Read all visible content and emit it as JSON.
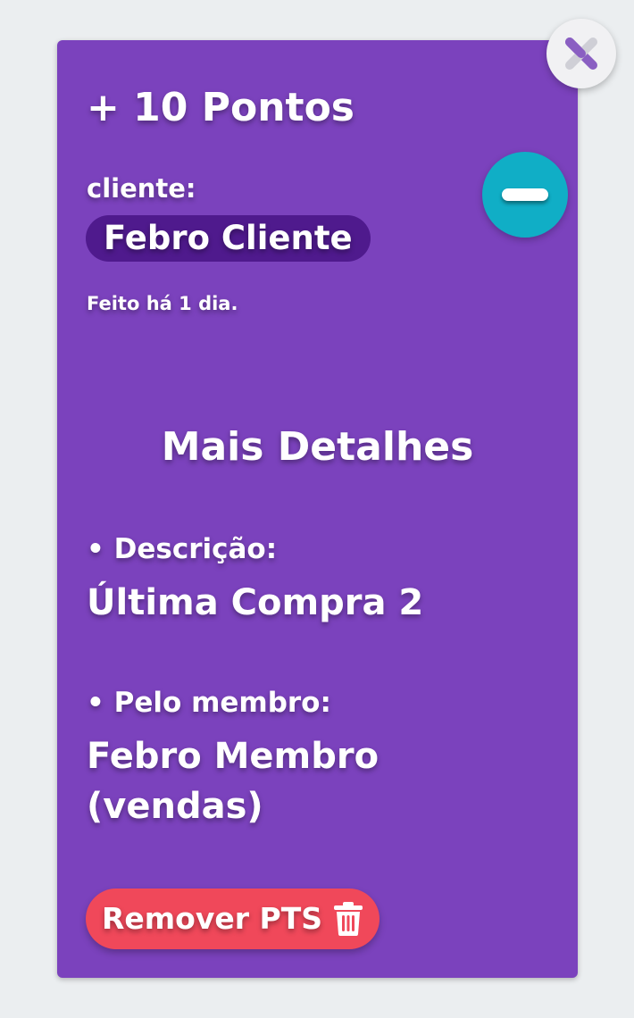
{
  "card": {
    "points_title": "+ 10 Pontos",
    "client_label": "cliente:",
    "client_name": "Febro Cliente",
    "time_ago": "Feito há 1 dia.",
    "details_title": "Mais Detalhes",
    "description_label": "• Descrição:",
    "description_value": "Última Compra 2",
    "member_label": "• Pelo membro:",
    "member_value": "Febro Membro (vendas)",
    "remove_button_label": "Remover PTS"
  },
  "icons": {
    "close": "close-icon",
    "minus": "minus-icon",
    "trash": "trash-icon"
  },
  "colors": {
    "card_background": "#7b42bd",
    "client_pill": "#4f1a8d",
    "minus_button": "#10aec6",
    "remove_button": "#f0485a",
    "page_background": "#ebeef0"
  }
}
